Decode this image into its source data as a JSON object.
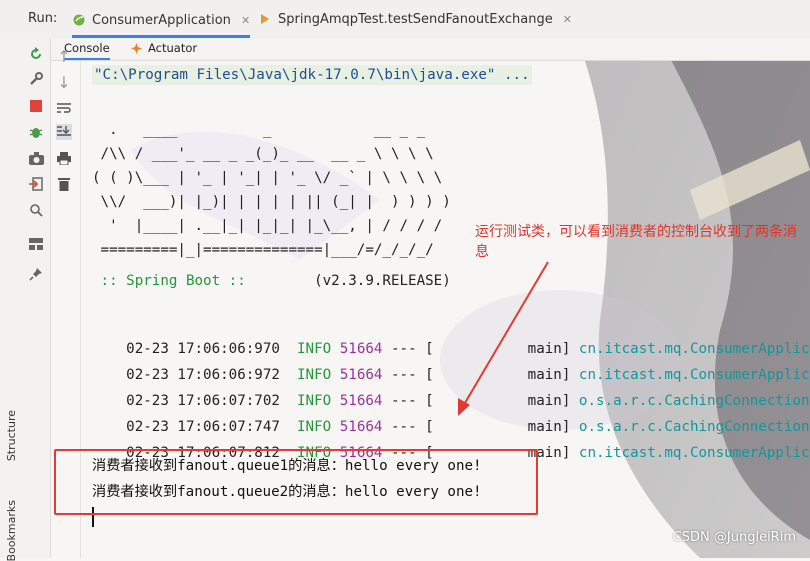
{
  "run_bar": {
    "label": "Run:",
    "tabs": [
      {
        "label": "ConsumerApplication",
        "active": true,
        "icon": "spring-run-icon"
      },
      {
        "label": "SpringAmqpTest.testSendFanoutExchange",
        "active": false,
        "icon": "test-run-icon"
      }
    ]
  },
  "console_tabs": [
    {
      "label": "Console",
      "active": true
    },
    {
      "label": "Actuator",
      "active": false,
      "icon": "actuator-icon"
    }
  ],
  "side_panels": {
    "structure": "Structure",
    "bookmarks": "Bookmarks"
  },
  "console": {
    "command": "\"C:\\Program Files\\Java\\jdk-17.0.7\\bin\\java.exe\" ...",
    "banner": [
      "  .   ____          _            __ _ _",
      " /\\\\ / ___'_ __ _ _(_)_ __  __ _ \\ \\ \\ \\",
      "( ( )\\___ | '_ | '_| | '_ \\/ _` | \\ \\ \\ \\",
      " \\\\/  ___)| |_)| | | | | || (_| |  ) ) ) )",
      "  '  |____| .__|_| |_|_| |_\\__, | / / / /",
      " =========|_|==============|___/=/_/_/_/"
    ],
    "spring_label": " :: Spring Boot :: ",
    "spring_version": "       (v2.3.9.RELEASE)",
    "logs": [
      {
        "ts": "02-23 17:06:06:970",
        "level": "INFO",
        "pid": "51664",
        "sep": " --- [",
        "thread": "           main]",
        "logger": "cn.itcast.mq.ConsumerApplic"
      },
      {
        "ts": "02-23 17:06:06:972",
        "level": "INFO",
        "pid": "51664",
        "sep": " --- [",
        "thread": "           main]",
        "logger": "cn.itcast.mq.ConsumerApplic"
      },
      {
        "ts": "02-23 17:06:07:702",
        "level": "INFO",
        "pid": "51664",
        "sep": " --- [",
        "thread": "           main]",
        "logger": "o.s.a.r.c.CachingConnection"
      },
      {
        "ts": "02-23 17:06:07:747",
        "level": "INFO",
        "pid": "51664",
        "sep": " --- [",
        "thread": "           main]",
        "logger": "o.s.a.r.c.CachingConnection"
      },
      {
        "ts": "02-23 17:06:07:812",
        "level": "INFO",
        "pid": "51664",
        "sep": " --- [",
        "thread": "           main]",
        "logger": "cn.itcast.mq.ConsumerApplic"
      }
    ],
    "messages": [
      "消费者接收到fanout.queue1的消息：hello every one!",
      "消费者接收到fanout.queue2的消息：hello every one!"
    ]
  },
  "annotation": {
    "text": "运行测试类，可以看到消费者的控制台收到了两条消息",
    "color": "#e2332a"
  },
  "watermark": "CSDN @JungleiRim"
}
